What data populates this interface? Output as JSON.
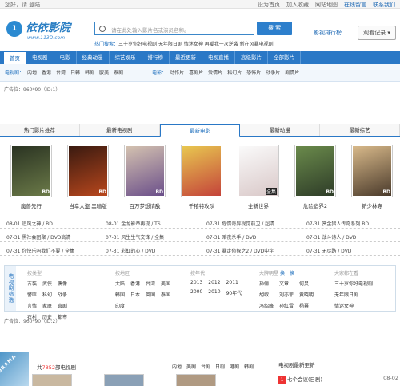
{
  "topbar": {
    "left_text": "您好，请 登陆",
    "right_links": [
      "设为首页",
      "加入收藏",
      "网站地图",
      "在线留言",
      "联系我们"
    ]
  },
  "logo": {
    "badge": "1",
    "name": "依依影院",
    "url_text": "www.113D.com"
  },
  "search": {
    "placeholder": "请在此处输入影片名或演员名称。",
    "button": "搜 索",
    "hot_label": "热门搜索：",
    "hot_words": "三十岁你好电视剧  无年限日剧  情迷女神  再爱我一次逆袭  新在风暴电视剧"
  },
  "header_links": {
    "rank": "影视排行榜",
    "history": "观看记录 ▾"
  },
  "nav": [
    "首页",
    "电视剧",
    "电影",
    "经典动漫",
    "综艺娱乐",
    "排行榜",
    "最近更新",
    "电视直播",
    "高级影片",
    "全部影片"
  ],
  "subnav": {
    "tv_label": "电视剧：",
    "tv_items": [
      "内地",
      "香港",
      "台湾",
      "日韩",
      "韩剧",
      "欧美",
      "泰剧"
    ],
    "movie_label": "电影：",
    "movie_items": [
      "动作片",
      "喜剧片",
      "爱情片",
      "科幻片",
      "恐怖片",
      "战争片",
      "剧情片"
    ]
  },
  "ad_top": "广告位：960*90（ID:1）",
  "ad_bottom": "广告位：960*90（ID:2）",
  "tabs": [
    "热门影片推荐",
    "最新电视剧",
    "最新电影",
    "最新动漫",
    "最新综艺"
  ],
  "posters": [
    {
      "title": "魔兽先行",
      "tag": "BD",
      "color": "#3d4a2c"
    },
    {
      "title": "当幸大盗 黑暗版",
      "tag": "BD",
      "color": "#7a2a14"
    },
    {
      "title": "百万梦想情敌",
      "tag": "BD",
      "color": "#8a7a66"
    },
    {
      "title": "千禧特攻队",
      "tag": "",
      "color": "#c9a63b"
    },
    {
      "title": "全新世界",
      "tag": "全集",
      "color": "#e6e6e6"
    },
    {
      "title": "危险宿界2",
      "tag": "BD",
      "color": "#4c5b3b"
    },
    {
      "title": "新少林寺",
      "tag": "BD",
      "color": "#b4956a"
    }
  ],
  "lists": [
    [
      "08-01  追风之神  /  BD",
      "08-01  金龙影帝再现  /  TS",
      "07-31  危情奇异视觉前卫  /  超清",
      "07-31  赏金猎人传奇系列 BD"
    ],
    [
      "07-31  黑社会团聚  /  DVD高清",
      "07-31  风生生气交锋  /  全集",
      "07-31  暗夜杀手  /  DVD",
      "07-31  战斗诗人  /  DVD"
    ],
    [
      "07-31  你快乐吗我们不要  /  全集",
      "07-31  彩虹的心  /  DVD",
      "07-31  暴走侦探之2  /  DVD中字",
      "07-31  无尽路  /  DVD"
    ]
  ],
  "filter": {
    "side": "电视剧筛选",
    "columns": [
      {
        "title": "按类型",
        "items": [
          "古装",
          "武侠",
          "偶像",
          "警匪",
          "科幻",
          "战争",
          "言情",
          "家庭",
          "喜剧",
          "农村",
          "历史",
          "都市"
        ]
      },
      {
        "title": "按地区",
        "items": [
          "大陆",
          "香港",
          "台湾",
          "美国",
          "韩国",
          "日本",
          "英国",
          "泰国",
          "印度"
        ]
      },
      {
        "title": "按年代",
        "items": [
          "2013",
          "2012",
          "2011",
          "2000",
          "2010",
          "90年代"
        ]
      },
      {
        "title": "大牌明星",
        "extra": "换一换",
        "items": [
          "孙俪",
          "文章",
          "何炅",
          "胡歌",
          "刘亦菲",
          "黄晓明",
          "冯绍峰",
          "孙红雷",
          "杨幂"
        ]
      },
      {
        "title": "大家都在看",
        "items": [
          "三十岁你好电视剧",
          "无年限日剧",
          "情迷女神"
        ]
      }
    ]
  },
  "drama": {
    "ribbon": "DRAMA",
    "count_prefix": "共",
    "count": "7852",
    "count_suffix": "部电视剧",
    "areas": [
      "内地",
      "美剧",
      "台剧",
      "日剧",
      "港剧",
      "韩剧"
    ]
  },
  "newtv": {
    "title": "电视剧最新更新",
    "first_rank": "1",
    "first_title": "七个会议(日剧)",
    "first_date": "08-02"
  }
}
